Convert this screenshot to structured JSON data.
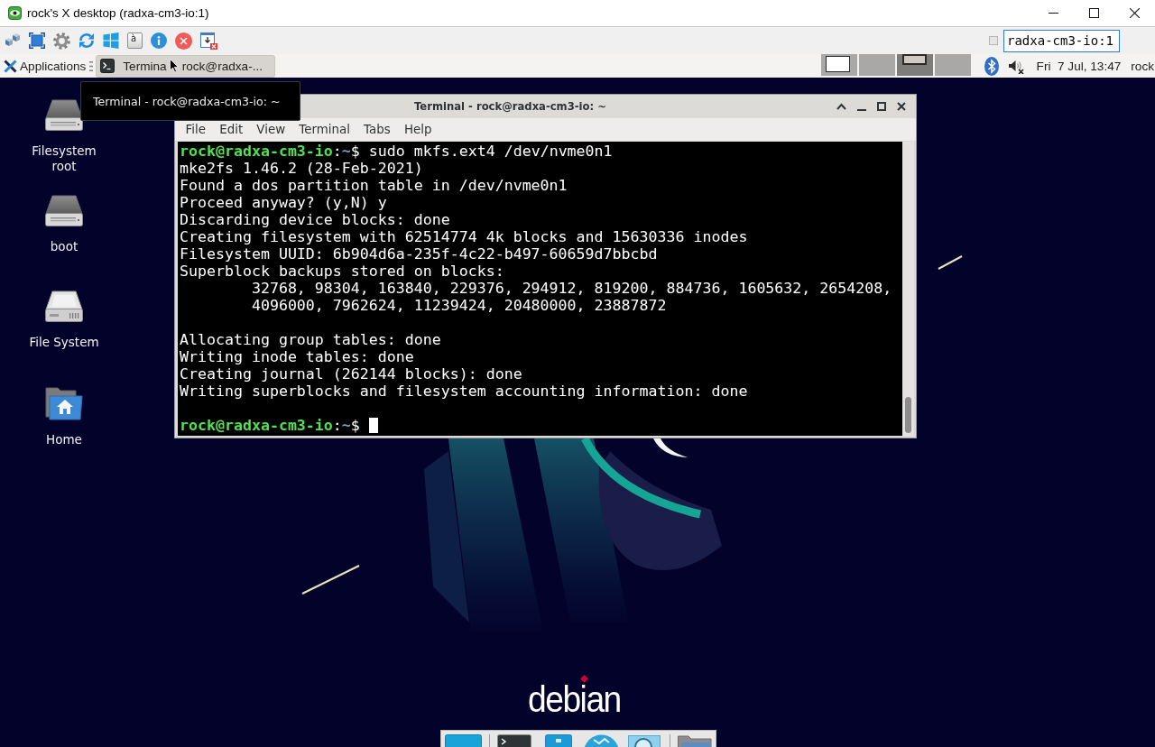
{
  "viewer_window": {
    "title": "rock's X desktop (radxa-cm3-io:1)"
  },
  "viewer_toolbar": {
    "key_label": "à",
    "host_field": {
      "value": "radxa-cm3-io:1"
    }
  },
  "desktop_panel": {
    "applications_label": "Applications",
    "tasks": [
      {
        "title_parts": [
          "Termina",
          "rock@radxa-..."
        ],
        "selected": true
      }
    ],
    "workspaces": [
      {
        "selected": false,
        "has_window": true
      },
      {
        "selected": false,
        "has_window": false
      },
      {
        "selected": true,
        "has_window": true
      },
      {
        "selected": false,
        "has_window": false
      }
    ],
    "volume": {
      "muted": true
    },
    "clock": "Fri  7 Jul, 13:47",
    "user": "rock"
  },
  "desktop": {
    "icons": [
      {
        "label": "Filesystem root",
        "kind": "drive"
      },
      {
        "label": "boot",
        "kind": "drive"
      },
      {
        "label": "File System",
        "kind": "harddisk"
      },
      {
        "label": "Home",
        "kind": "home"
      }
    ],
    "logo": "debian"
  },
  "tooltip": {
    "text": "Terminal - rock@radxa-cm3-io: ~"
  },
  "terminal": {
    "title": "Terminal - rock@radxa-cm3-io: ~",
    "menu": [
      "File",
      "Edit",
      "View",
      "Terminal",
      "Tabs",
      "Help"
    ],
    "blocks": [
      [
        {
          "kind": "prompt",
          "user_host": "rock@radxa-cm3-io",
          "separator": ":",
          "path": "~",
          "symbol": "$",
          "command": "sudo mkfs.ext4 /dev/nvme0n1",
          "cursor": false
        },
        {
          "kind": "output",
          "text": "mke2fs 1.46.2 (28-Feb-2021)"
        },
        {
          "kind": "output",
          "text": "Found a dos partition table in /dev/nvme0n1"
        },
        {
          "kind": "output",
          "text": "Proceed anyway? (y,N) y"
        },
        {
          "kind": "output",
          "text": "Discarding device blocks: done"
        },
        {
          "kind": "output",
          "text": "Creating filesystem with 62514774 4k blocks and 15630336 inodes"
        },
        {
          "kind": "output",
          "text": "Filesystem UUID: 6b904d6a-235f-4c22-b497-60659d7bbcbd"
        },
        {
          "kind": "output",
          "text": "Superblock backups stored on blocks:"
        },
        {
          "kind": "output",
          "text": "        32768, 98304, 163840, 229376, 294912, 819200, 884736, 1605632, 2654208,"
        },
        {
          "kind": "output",
          "text": "        4096000, 7962624, 11239424, 20480000, 23887872"
        }
      ],
      [
        {
          "kind": "output",
          "text": "Allocating group tables: done"
        },
        {
          "kind": "output",
          "text": "Writing inode tables: done"
        },
        {
          "kind": "output",
          "text": "Creating journal (262144 blocks): done"
        },
        {
          "kind": "output",
          "text": "Writing superblocks and filesystem accounting information: done"
        }
      ],
      [
        {
          "kind": "prompt",
          "user_host": "rock@radxa-cm3-io",
          "separator": ":",
          "path": "~",
          "symbol": "$",
          "cursor": true
        }
      ]
    ]
  }
}
